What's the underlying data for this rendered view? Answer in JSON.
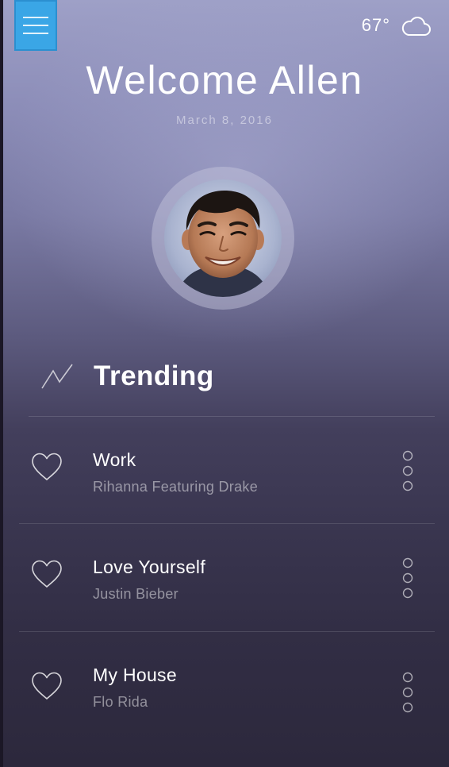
{
  "header": {
    "menu_icon": "hamburger-menu-icon",
    "menu_color": "#3aa6e6",
    "temperature": "67°",
    "weather_icon": "cloud-icon"
  },
  "greeting": {
    "title": "Welcome Allen",
    "date": "March 8, 2016"
  },
  "profile": {
    "avatar": "user-avatar-photo"
  },
  "trending": {
    "icon": "trending-line-icon",
    "title": "Trending"
  },
  "songs": [
    {
      "title": "Work",
      "artist": "Rihanna Featuring Drake",
      "favorite_icon": "heart-outline-icon",
      "more_icon": "vertical-dots-icon"
    },
    {
      "title": "Love Yourself",
      "artist": "Justin Bieber",
      "favorite_icon": "heart-outline-icon",
      "more_icon": "vertical-dots-icon"
    },
    {
      "title": "My House",
      "artist": "Flo Rida",
      "favorite_icon": "heart-outline-icon",
      "more_icon": "vertical-dots-icon"
    }
  ]
}
